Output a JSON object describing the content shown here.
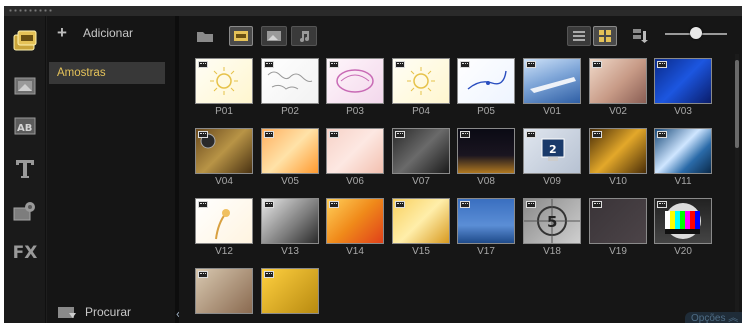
{
  "library": {
    "add_label": "Adicionar",
    "folder_item": "Amostras",
    "browse_label": "Procurar"
  },
  "footer": {
    "options_label": "Opções"
  },
  "rail_icons": [
    "media-icon",
    "transition-icon",
    "title-ab-icon",
    "text-icon",
    "effects-icon",
    "fx-icon"
  ],
  "rail_labels": {
    "fx": "FX"
  },
  "toolbar": {
    "zoom_level": 0.45
  },
  "thumbnails": [
    {
      "label": "P01",
      "bg": "linear-gradient(135deg,#fffef6,#fff6cf)",
      "mark": "sun"
    },
    {
      "label": "P02",
      "bg": "linear-gradient(135deg,#ffffff,#f2f2f2)",
      "mark": "map"
    },
    {
      "label": "P03",
      "bg": "linear-gradient(135deg,#fff6fb,#f3d8ec)",
      "mark": "pink"
    },
    {
      "label": "P04",
      "bg": "linear-gradient(135deg,#fffef6,#fff6cf)",
      "mark": "sun2"
    },
    {
      "label": "P05",
      "bg": "linear-gradient(135deg,#ffffff,#eef4ff)",
      "mark": "blue"
    },
    {
      "label": "V01",
      "bg": "linear-gradient(160deg,#cfe2f8 0%,#7fa6d8 45%,#2f5fa5 100%)",
      "mark": "plane"
    },
    {
      "label": "V02",
      "bg": "linear-gradient(135deg,#f0d9c9,#c79a86 55%,#8a5e54)",
      "mark": ""
    },
    {
      "label": "V03",
      "bg": "linear-gradient(135deg,#0a2a8a,#1c56e0 50%,#0a1c6a)",
      "mark": ""
    },
    {
      "label": "V04",
      "bg": "linear-gradient(135deg,#6a4a1e,#b89446 50%,#4a3212)",
      "mark": "reel"
    },
    {
      "label": "V05",
      "bg": "linear-gradient(135deg,#ffb060,#ffe2a8 50%,#ff9a30)",
      "mark": ""
    },
    {
      "label": "V06",
      "bg": "linear-gradient(135deg,#f7d2c8,#fde8e2 50%,#f3c0b0)",
      "mark": ""
    },
    {
      "label": "V07",
      "bg": "linear-gradient(135deg,#2a2a2a,#6a6a6a 50%,#1a1a1a)",
      "mark": ""
    },
    {
      "label": "V08",
      "bg": "linear-gradient(180deg,#0a0a14 0%,#1a1520 60%,#b07820 100%)",
      "mark": ""
    },
    {
      "label": "V09",
      "bg": "linear-gradient(135deg,#e0e6ef,#b7c2d2)",
      "mark": "monitor"
    },
    {
      "label": "V10",
      "bg": "linear-gradient(135deg,#4a2e08,#e3a82a 50%,#4a2e08)",
      "mark": ""
    },
    {
      "label": "V11",
      "bg": "linear-gradient(135deg,#1a4a7a,#cfe6ff 45%,#2a6aa8 70%,#0a2a4a)",
      "mark": ""
    },
    {
      "label": "V12",
      "bg": "linear-gradient(135deg,#ffffff,#fff4e0)",
      "mark": "flower"
    },
    {
      "label": "V13",
      "bg": "linear-gradient(135deg,#e8e8e8,#7a7a7a 60%,#2a2a2a)",
      "mark": ""
    },
    {
      "label": "V14",
      "bg": "linear-gradient(135deg,#ffcf5a,#f08a1a 50%,#e0401a)",
      "mark": ""
    },
    {
      "label": "V15",
      "bg": "linear-gradient(135deg,#f8d060,#ffeeaa 50%,#d89a20)",
      "mark": ""
    },
    {
      "label": "V17",
      "bg": "linear-gradient(180deg,#3a6fc0 0%,#5b8ed6 60%,#1e4a8a 100%)",
      "mark": ""
    },
    {
      "label": "V18",
      "bg": "linear-gradient(135deg,#8a8a8a,#cfcfcf)",
      "mark": "countdown",
      "num": "5"
    },
    {
      "label": "V19",
      "bg": "linear-gradient(135deg,#3a3438,#4c4448)",
      "mark": ""
    },
    {
      "label": "V20",
      "bg": "linear-gradient(180deg,#222 0%,#444 100%)",
      "mark": "testcard"
    },
    {
      "label": "",
      "bg": "linear-gradient(135deg,#d8c8b0,#8a6a50)",
      "mark": ""
    },
    {
      "label": "",
      "bg": "linear-gradient(135deg,#ffd040,#b88a10)",
      "mark": ""
    }
  ],
  "monitor_badge": "2"
}
